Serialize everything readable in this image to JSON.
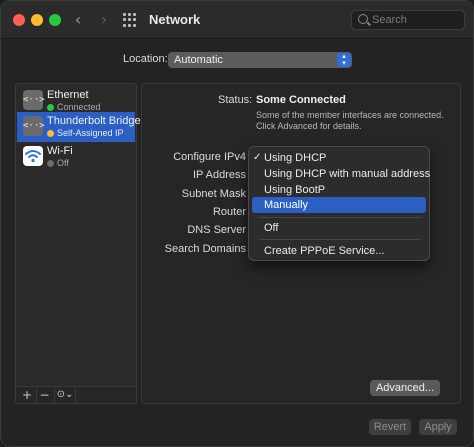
{
  "window": {
    "title": "Network"
  },
  "toolbar": {
    "back_icon": "chevron-left",
    "forward_icon": "chevron-right",
    "grid_icon": "grid-icon",
    "search_placeholder": "Search"
  },
  "location": {
    "label": "Location:",
    "value": "Automatic"
  },
  "sidebar": {
    "services": [
      {
        "name": "Ethernet",
        "status": "Connected",
        "status_color": "#28c840",
        "icon": "<··>"
      },
      {
        "name": "Thunderbolt Bridge",
        "status": "Self-Assigned IP",
        "status_color": "#febc2e",
        "icon": "<··>",
        "selected": true
      },
      {
        "name": "Wi-Fi",
        "status": "Off",
        "status_color": "#6b6b6b",
        "icon": "wifi"
      }
    ],
    "tools": {
      "add": "+",
      "remove": "−",
      "action": "⊙⌄"
    }
  },
  "detail": {
    "status_label": "Status:",
    "status_value": "Some Connected",
    "status_description": "Some of the member interfaces are connected. Click Advanced for details.",
    "labels": {
      "configure_ipv4": "Configure IPv4",
      "ip_address": "IP Address",
      "subnet_mask": "Subnet Mask",
      "router": "Router",
      "dns_server": "DNS Server",
      "search_domains": "Search Domains"
    },
    "advanced_button": "Advanced...",
    "revert_button": "Revert",
    "apply_button": "Apply"
  },
  "ipv4_menu": {
    "items": [
      {
        "label": "Using DHCP",
        "checked": true
      },
      {
        "label": "Using DHCP with manual address"
      },
      {
        "label": "Using BootP"
      },
      {
        "label": "Manually",
        "highlighted": true
      },
      {
        "label": "Off"
      },
      {
        "label": "Create PPPoE Service..."
      }
    ],
    "check_glyph": "✓"
  },
  "colors": {
    "accent": "#2c5fc4",
    "close": "#fe5f57",
    "minimize": "#febc2e",
    "maximize": "#28c840"
  }
}
